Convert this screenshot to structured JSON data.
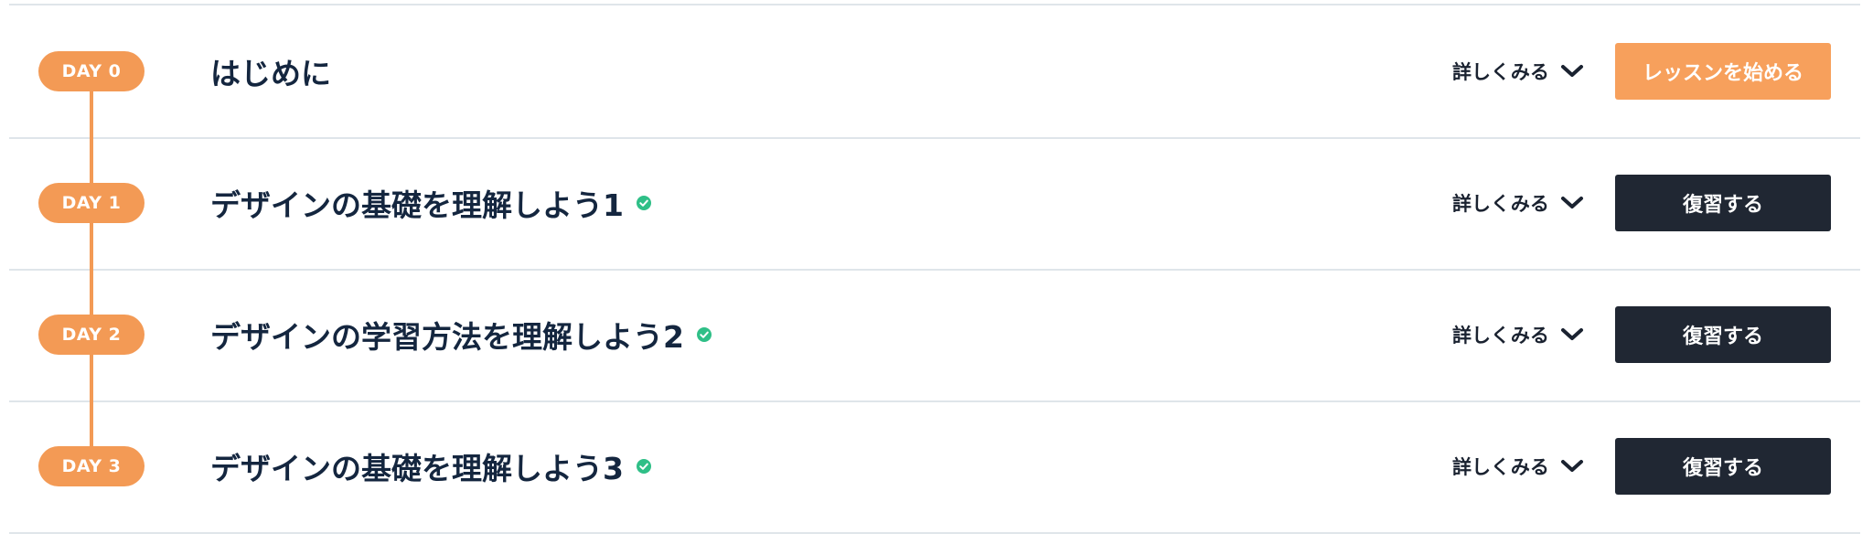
{
  "lessons": [
    {
      "day_label": "DAY 0",
      "title": "はじめに",
      "completed": false,
      "detail_label": "詳しくみる",
      "action_label": "レッスンを始める",
      "action_style": "primary"
    },
    {
      "day_label": "DAY 1",
      "title": "デザインの基礎を理解しよう1",
      "completed": true,
      "detail_label": "詳しくみる",
      "action_label": "復習する",
      "action_style": "dark"
    },
    {
      "day_label": "DAY 2",
      "title": "デザインの学習方法を理解しよう2",
      "completed": true,
      "detail_label": "詳しくみる",
      "action_label": "復習する",
      "action_style": "dark"
    },
    {
      "day_label": "DAY 3",
      "title": "デザインの基礎を理解しよう3",
      "completed": true,
      "detail_label": "詳しくみる",
      "action_label": "復習する",
      "action_style": "dark"
    }
  ],
  "colors": {
    "accent": "#f39a55",
    "primary_button": "#f7a05c",
    "dark_button": "#202733",
    "title_text": "#14263f",
    "check": "#2fbf87",
    "divider": "#dfe5ea"
  },
  "icons": {
    "completed": "check-circle-icon",
    "expand": "chevron-down-icon"
  }
}
